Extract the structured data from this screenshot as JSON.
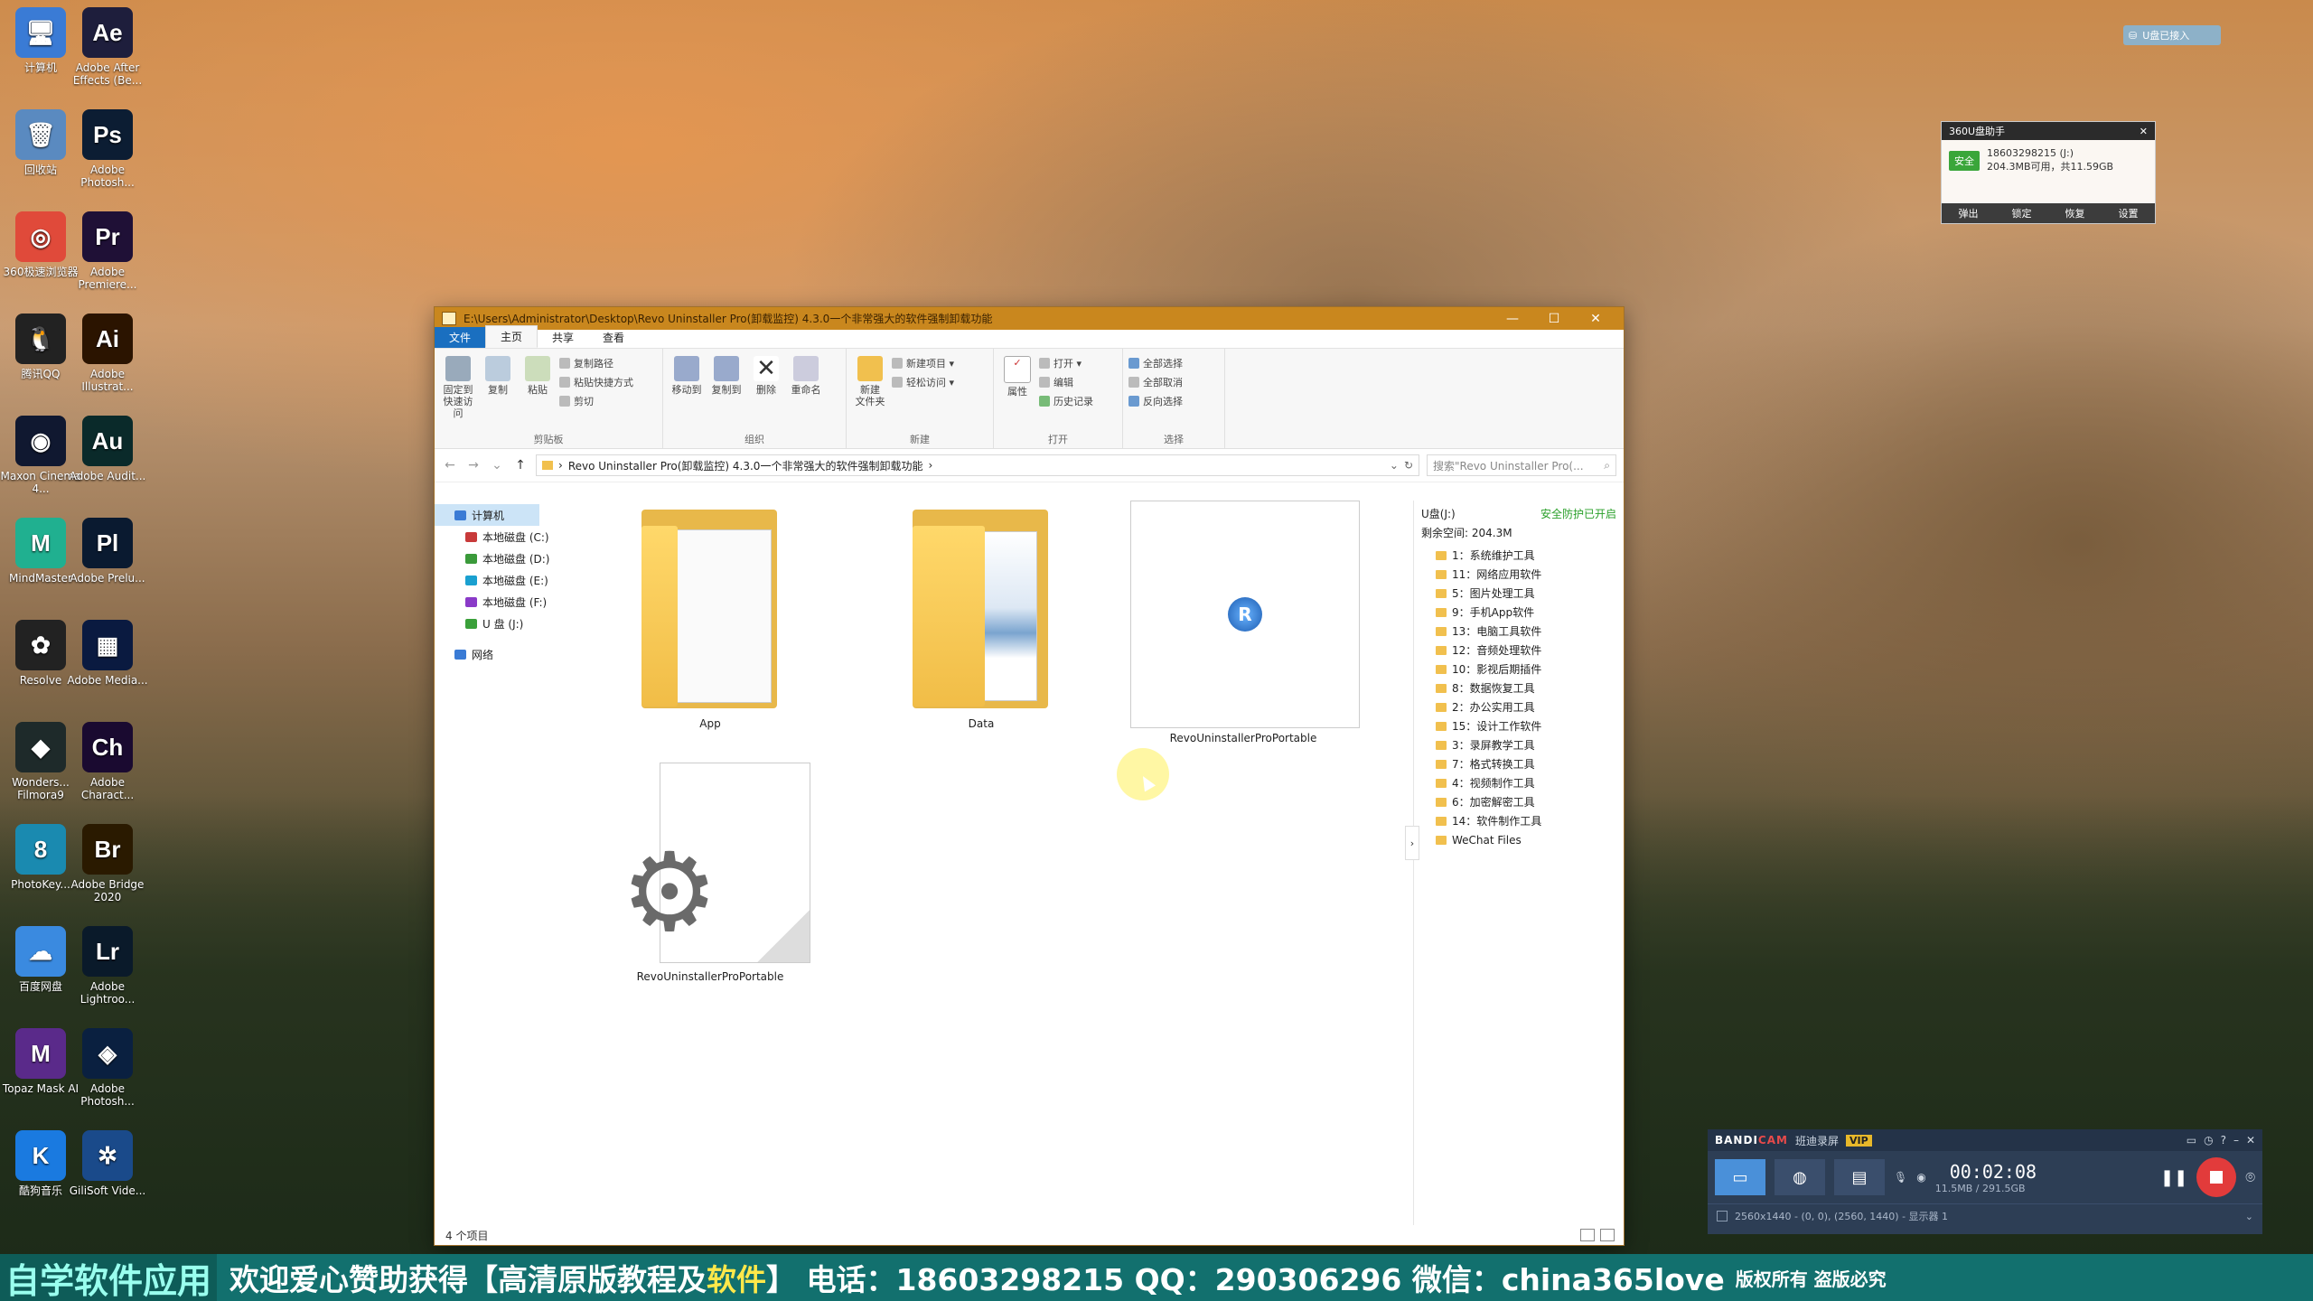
{
  "desktop": {
    "icons": [
      {
        "label": "计算机",
        "glyph": "🖥",
        "color": "#3a7bd5",
        "icon": "computer-icon"
      },
      {
        "label": "Adobe After Effects (Be...",
        "glyph": "Ae",
        "color": "#1e1e3c",
        "icon": "after-effects-icon"
      },
      {
        "label": "回收站",
        "glyph": "🗑",
        "color": "#5a8ac0",
        "icon": "recycle-bin-icon"
      },
      {
        "label": "Adobe Photosh...",
        "glyph": "Ps",
        "color": "#0c1d33",
        "icon": "photoshop-icon"
      },
      {
        "label": "360极速浏览器",
        "glyph": "◎",
        "color": "#e04a3a",
        "icon": "browser-360-icon"
      },
      {
        "label": "Adobe Premiere...",
        "glyph": "Pr",
        "color": "#1f1036",
        "icon": "premiere-icon"
      },
      {
        "label": "腾讯QQ",
        "glyph": "🐧",
        "color": "#222",
        "icon": "qq-icon"
      },
      {
        "label": "Adobe Illustrat...",
        "glyph": "Ai",
        "color": "#2b1400",
        "icon": "illustrator-icon"
      },
      {
        "label": "Maxon Cinema 4...",
        "glyph": "◉",
        "color": "#101830",
        "icon": "cinema4d-icon"
      },
      {
        "label": "Adobe Audit...",
        "glyph": "Au",
        "color": "#0a2a2a",
        "icon": "audition-icon"
      },
      {
        "label": "MindMaster",
        "glyph": "M",
        "color": "#20b090",
        "icon": "mindmaster-icon"
      },
      {
        "label": "Adobe Prelu...",
        "glyph": "Pl",
        "color": "#0a1a30",
        "icon": "prelude-icon"
      },
      {
        "label": "Resolve",
        "glyph": "✿",
        "color": "#222",
        "icon": "resolve-icon"
      },
      {
        "label": "Adobe Media...",
        "glyph": "▦",
        "color": "#0a1a40",
        "icon": "media-encoder-icon"
      },
      {
        "label": "Wonders... Filmora9",
        "glyph": "◆",
        "color": "#1e2a2a",
        "icon": "filmora-icon"
      },
      {
        "label": "Adobe Charact...",
        "glyph": "Ch",
        "color": "#1a0a30",
        "icon": "character-animator-icon"
      },
      {
        "label": "PhotoKey...",
        "glyph": "8",
        "color": "#1a8ab0",
        "icon": "photokey-icon"
      },
      {
        "label": "Adobe Bridge 2020",
        "glyph": "Br",
        "color": "#2a1a00",
        "icon": "bridge-icon"
      },
      {
        "label": "百度网盘",
        "glyph": "☁",
        "color": "#3a8ae0",
        "icon": "baidu-netdisk-icon"
      },
      {
        "label": "Adobe Lightroo...",
        "glyph": "Lr",
        "color": "#0a1a2a",
        "icon": "lightroom-icon"
      },
      {
        "label": "Topaz Mask AI",
        "glyph": "M",
        "color": "#5a2a8a",
        "icon": "topaz-mask-icon"
      },
      {
        "label": "Adobe Photosh...",
        "glyph": "◈",
        "color": "#0a2040",
        "icon": "photoshop-elements-icon"
      },
      {
        "label": "酷狗音乐",
        "glyph": "K",
        "color": "#1a7ae0",
        "icon": "kugou-icon"
      },
      {
        "label": "GiliSoft Vide...",
        "glyph": "✲",
        "color": "#1a4a8a",
        "icon": "gilisoft-icon"
      }
    ]
  },
  "explorer": {
    "title": "E:\\Users\\Administrator\\Desktop\\Revo Uninstaller Pro(卸载监控) 4.3.0一个非常强大的软件强制卸载功能",
    "window_buttons": [
      "—",
      "☐",
      "✕"
    ],
    "tabs": [
      {
        "label": "文件",
        "kind": "file"
      },
      {
        "label": "主页",
        "kind": "active"
      },
      {
        "label": "共享",
        "kind": ""
      },
      {
        "label": "查看",
        "kind": ""
      }
    ],
    "ribbon": {
      "clipboard": {
        "name": "剪贴板",
        "pin": "固定到快速访问",
        "copy": "复制",
        "paste": "粘贴",
        "copy_path": "复制路径",
        "paste_shortcut": "粘贴快捷方式",
        "cut": "剪切"
      },
      "organize": {
        "name": "组织",
        "move_to": "移动到",
        "copy_to": "复制到",
        "delete": "删除",
        "rename": "重命名"
      },
      "new": {
        "name": "新建",
        "new_folder": "新建\n文件夹",
        "new_item": "新建项目 ▾",
        "easy_access": "轻松访问 ▾"
      },
      "open": {
        "name": "打开",
        "properties": "属性",
        "open": "打开 ▾",
        "edit": "编辑",
        "history": "历史记录"
      },
      "select": {
        "name": "选择",
        "select_all": "全部选择",
        "select_none": "全部取消",
        "invert": "反向选择"
      }
    },
    "address": {
      "path": "Revo Uninstaller Pro(卸载监控) 4.3.0一个非常强大的软件强制卸载功能",
      "search_placeholder": "搜索\"Revo Uninstaller Pro(..."
    },
    "nav": [
      {
        "label": "计算机",
        "kind": "sel",
        "color": "#3a7bd5"
      },
      {
        "label": "本地磁盘 (C:)",
        "kind": "child",
        "color": "#c83a3a"
      },
      {
        "label": "本地磁盘 (D:)",
        "kind": "child",
        "color": "#3a9a3a"
      },
      {
        "label": "本地磁盘 (E:)",
        "kind": "child",
        "color": "#1aa0d0"
      },
      {
        "label": "本地磁盘 (F:)",
        "kind": "child",
        "color": "#8a3ac8"
      },
      {
        "label": "U 盘 (J:)",
        "kind": "child",
        "color": "#3aa03a"
      },
      {
        "label": "",
        "kind": "spacer",
        "color": ""
      },
      {
        "label": "网络",
        "kind": "",
        "color": "#3a7bd5"
      }
    ],
    "files": [
      {
        "name": "App",
        "type": "folder-doc"
      },
      {
        "name": "Data",
        "type": "folder-docs"
      },
      {
        "name": "RevoUninstallerProPortable",
        "type": "exe-selected"
      },
      {
        "name": "RevoUninstallerProPortable",
        "type": "config"
      }
    ],
    "status": "4 个项目",
    "right_pane": {
      "drive": "U盘(J:)",
      "protection": "安全防护已开启",
      "free": "剩余空间: 204.3M",
      "folders": [
        "1：系统维护工具",
        "11：网络应用软件",
        "5：图片处理工具",
        "9：手机App软件",
        "13：电脑工具软件",
        "12：音频处理软件",
        "10：影视后期插件",
        "8：数据恢复工具",
        "2：办公实用工具",
        "15：设计工作软件",
        "3：录屏教学工具",
        "7：格式转换工具",
        "4：视频制作工具",
        "6：加密解密工具",
        "14：软件制作工具",
        "WeChat Files"
      ]
    }
  },
  "widget360": {
    "title": "360U盘助手",
    "badge": "安全",
    "account": "18603298215 (J:)",
    "usage": "204.3MB可用，共11.59GB",
    "buttons": [
      "弹出",
      "锁定",
      "恢复",
      "设置"
    ],
    "tray": "U盘已接入"
  },
  "bandicam": {
    "logo_a": "BANDI",
    "logo_b": "CAM",
    "mode": "班迪录屏",
    "vip": "VIP",
    "time": "00:02:08",
    "size": "11.5MB / 291.5GB",
    "capture_info": "2560x1440 - (0, 0), (2560, 1440) - 显示器 1"
  },
  "banner": {
    "left": "自学软件应用",
    "main_a": "欢迎爱心赞助获得【高清原版教程及",
    "main_hl": "软件",
    "main_b": "】 电话：18603298215 QQ：290306296 微信：china365love",
    "right": "版权所有 盗版必究"
  }
}
